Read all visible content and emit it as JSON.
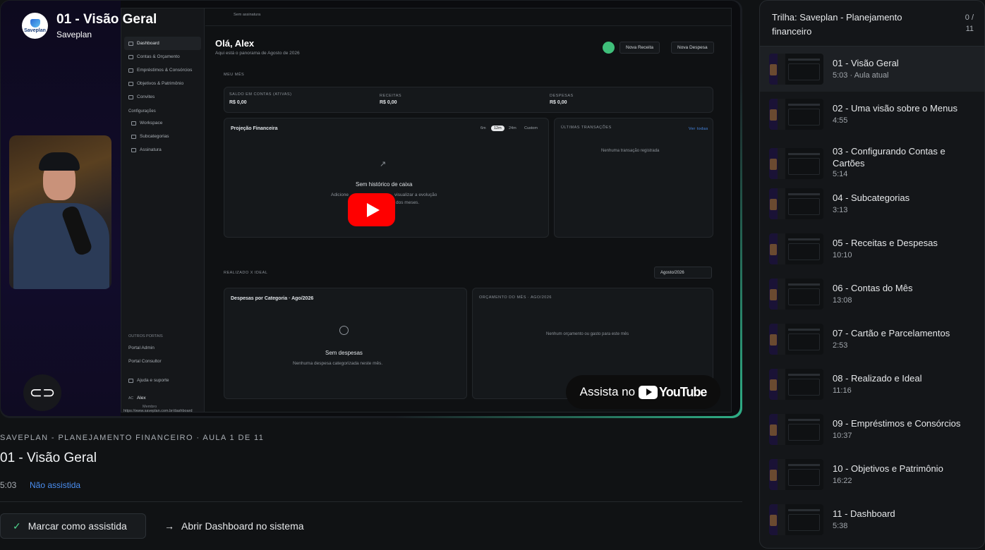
{
  "video": {
    "title": "01 - Visão Geral",
    "channel": "Saveplan",
    "channel_logo_text": "Saveplan",
    "watch_on": "Assista no",
    "youtube_wordmark": "YouTube",
    "embedded_app": {
      "sidebar": [
        {
          "label": "Dashboard",
          "active": true
        },
        {
          "label": "Contas & Orçamento"
        },
        {
          "label": "Empréstimos & Consórcios"
        },
        {
          "label": "Objetivos & Patrimônio"
        },
        {
          "label": "Convites"
        }
      ],
      "config_label": "Configurações",
      "config_items": [
        "Workspace",
        "Subcategorias",
        "Assinatura"
      ],
      "other_portals_label": "OUTROS PORTAIS",
      "portal_items": [
        "Portal Admin",
        "Portal Consultor"
      ],
      "help": "Ajuda e suporte",
      "user_name": "Alex",
      "user_role": "Membro",
      "user_initials": "AC",
      "url": "https://www.saveplan.com.br/dashboard",
      "top_status": "Sem assinatura",
      "greeting": "Olá, Alex",
      "greeting_sub": "Aqui está o panorama de Agosto de 2026",
      "btn_receita": "Nova Receita",
      "btn_despesa": "Nova Despesa",
      "my_month": "MEU MÊS",
      "saldo_label": "SALDO EM CONTAS (ATIVAS)",
      "saldo_value": "R$ 0,00",
      "receitas_label": "RECEITAS",
      "receitas_value": "R$ 0,00",
      "despesas_label": "DESPESAS",
      "despesas_value": "R$ 0,00",
      "projection_title": "Projeção Financeira",
      "range_options": [
        "6m",
        "12m",
        "24m",
        "Custom"
      ],
      "no_history": "Sem histórico de caixa",
      "no_history_sub_1": "Adicione",
      "no_history_sub_1b": "visualizar a evolução",
      "no_history_sub_2": "dos meses.",
      "last_tx_title": "ÚLTIMAS TRANSAÇÕES",
      "see_all": "Ver todas",
      "no_tx": "Nenhuma transação registrada",
      "realized_label": "REALIZADO X IDEAL",
      "month_select": "Agosto/2026",
      "expenses_cat_title": "Despesas por Categoria · Ago/2026",
      "no_expenses": "Sem despesas",
      "no_expenses_sub": "Nenhuma despesa categorizada neste mês.",
      "budget_title": "ORÇAMENTO DO MÊS · AGO/2026",
      "no_budget": "Nenhum orçamento ou gasto para este mês"
    }
  },
  "lesson": {
    "course_meta": "SAVEPLAN - PLANEJAMENTO FINANCEIRO · AULA 1 DE 11",
    "title": "01 - Visão Geral",
    "duration": "5:03",
    "status": "Não assistida",
    "mark_watched": "Marcar como assistida",
    "open_dashboard": "Abrir Dashboard no sistema"
  },
  "playlist": {
    "title": "Trilha: Saveplan - Planejamento financeiro",
    "progress": "0 / 11",
    "items": [
      {
        "title": "01 - Visão Geral",
        "sub": "5:03 · Aula atual",
        "current": true
      },
      {
        "title": "02 - Uma visão sobre o Menus",
        "sub": "4:55"
      },
      {
        "title": "03 - Configurando Contas e Cartões",
        "sub": "5:14"
      },
      {
        "title": "04 - Subcategorias",
        "sub": "3:13"
      },
      {
        "title": "05 - Receitas e Despesas",
        "sub": "10:10"
      },
      {
        "title": "06 - Contas do Mês",
        "sub": "13:08"
      },
      {
        "title": "07 - Cartão e Parcelamentos",
        "sub": "2:53"
      },
      {
        "title": "08 - Realizado e Ideal",
        "sub": "11:16"
      },
      {
        "title": "09 - Empréstimos e Consórcios",
        "sub": "10:37"
      },
      {
        "title": "10 - Objetivos e Patrimônio",
        "sub": "16:22"
      },
      {
        "title": "11 - Dashboard",
        "sub": "5:38"
      }
    ]
  },
  "colors": {
    "accent_green": "#4fd08b",
    "link_blue": "#4a8ef0",
    "youtube_red": "#ff0000"
  }
}
